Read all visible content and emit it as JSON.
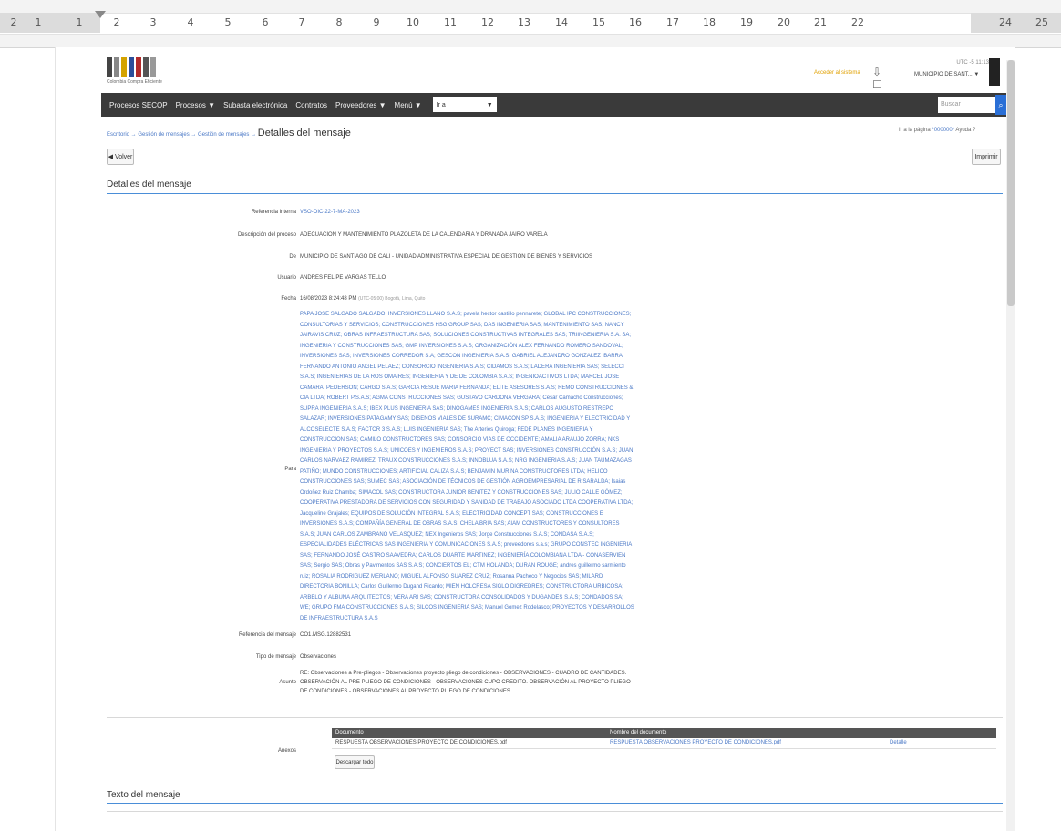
{
  "ruler": {
    "ticks": [
      "2",
      "1",
      "1",
      "2",
      "3",
      "4",
      "5",
      "6",
      "7",
      "8",
      "9",
      "10",
      "11",
      "12",
      "13",
      "14",
      "15",
      "16",
      "17",
      "18",
      "19",
      "20",
      "21",
      "22",
      "24",
      "25"
    ]
  },
  "header": {
    "logo_text": "Colombia Compra Eficiente",
    "notice": "Acceder al sistema",
    "user_time": "UTC -5 11:13",
    "user_entity": "MUNICIPIO DE SANT..."
  },
  "nav": {
    "items": [
      "Procesos SECOP",
      "Procesos ▼",
      "Subasta electrónica",
      "Contratos",
      "Proveedores ▼",
      "Menú ▼"
    ],
    "select_value": "Ir a",
    "search_placeholder": "Buscar"
  },
  "breadcrumb": {
    "path": "Escritorio → Gestión de mensajes → Gestión de mensajes →",
    "current": "Detalles del mensaje",
    "help_prefix": "Ir a la página",
    "help_link": "*000000*",
    "help_label": "Ayuda"
  },
  "buttons": {
    "back": "Volver",
    "print": "Imprimir",
    "download": "Descargar todo"
  },
  "details": {
    "section_title": "Detalles del mensaje",
    "fields": [
      {
        "label": "Referencia interna",
        "value": "VSO-OIC-22-7-MA-2023"
      },
      {
        "label": "Descripción del proceso",
        "value": "ADECUACIÓN Y MANTENIMIENTO PLAZOLETA DE LA CALENDARIA Y DRANADA JAIRO VARELA"
      },
      {
        "label": "De",
        "value": "MUNICIPIO DE SANTIAGO DE CALI - UNIDAD ADMINISTRATIVA ESPECIAL DE GESTION DE BIENES Y SERVICIOS"
      },
      {
        "label": "Usuario",
        "value": "ANDRES FELIPE VARGAS TELLO"
      },
      {
        "label": "Fecha",
        "value": "16/08/2023 8:24:48 PM",
        "note": "(UTC-05:00) Bogotá, Lima, Quito"
      }
    ],
    "para_label": "Para",
    "recipients": "PAPA JOSE SALGADO SALGADO; INVERSIONES LLANO S.A.S; pavela hector castillo pennarete; GLOBAL IPC CONSTRUCCIONES; CONSULTORIAS Y SERVICIOS; CONSTRUCCIONES HSG GROUP SAS; DAS INGENIERIA SAS; MANTENIMIENTO SAS; NANCY JAIRAVIS CRUZ; OBRAS INFRAESTRUCTURA SAS; SOLUCIONES CONSTRUCTIVAS INTEGRALES SAS; TRIINGENIERIA S.A. SA; INGENIERIA Y CONSTRUCCIONES SAS; GMP INVERSIONES S.A.S; ORGANIZACIÓN ALEX FERNANDO ROMERO SANDOVAL; INVERSIONES SAS; INVERSIONES CORREDOR S.A; GESCON INGENIERIA S.A.S; GABRIEL ALEJANDRO GONZALEZ IBARRA; FERNANDO ANTONIO ANGEL PELAEZ; CONSORCIO INGENIERIA S.A.S; CIDAMOS S.A.S; LADERA INGENIERIA SAS; SELECCI S.A.S; INGENIERIAS DE LA ROS OMAIRES; INGENIERIA Y DE DE COLOMBIA S.A.S; INGENIOACTIVOS LTDA; MARCEL JOSE CAMARA; PEDERSON; CARGO S.A.S; GARCIA RESUE MARIA FERNANDA; ELITE ASESORES S.A.S; REMO CONSTRUCCIONES & CIA LTDA; ROBERT P.S.A.S; AGMA CONSTRUCCIONES SAS; GUSTAVO CARDONA VERGARA; Cesar Camacho Construcciones; SUPRA INGENIERIA S.A.S; IBEX PLUS INGENIERIA SAS; DINOGAMES INGENIERIA S.A.S; CARLOS AUGUSTO RESTREPO SALAZAR; INVERSIONES PATAGAMY SAS; DISEÑOS VIALES DE SURAMC; CIMACON SP S.A.S; INGENIERIA Y ELECTRICIDAD Y ALCOSELECTE S.A.S; FACTOR 3 S.A.S; LUIS INGENIERIA SAS; The Arteries Quiroga; FEDE PLANES INGENIERIA Y CONSTRUCCIÓN SAS; CAMILO CONSTRUCTORES SAS; CONSORCIO VÍAS DE OCCIDENTE; AMALIA ARAÚJO ZORRA; NKS INGENIERIA Y PROYECTOS S.A.S; UNICOES Y INGENIEROS S.A.S; PROYECT SAS; INVERSIONES CONSTRUCCIÓN S.A.S; JUAN CARLOS NARVAEZ RAMIREZ; TRAUX CONSTRUCCIONES S.A.S; INNOBLUA S.A.S; NRG INGENIERIA S.A.S; JUAN TAUMAZAGAS PATIÑO; MUNDO CONSTRUCCIONES; ARTIFICIAL CALIZA S.A.S; BENJAMIN MURINA CONSTRUCTORES LTDA; HELICO CONSTRUCCIONES SAS; SUMEC SAS; ASOCIACIÓN DE TÉCNICOS DE GESTIÓN AGROEMPRESARIAL DE RISARALDA; Isaias Ordoñez Ruiz Chamba; SIMACOL SAS; CONSTRUCTORA JUNIOR BENITEZ Y CONSTRUCCIONES SAS; JULIO CALLE GÓMEZ; COOPERATIVA PRESTADORA DE SERVICIOS CON SEGURIDAD Y SANIDAD DE TRABAJO ASOCIADO LTDA COOPERATIVA LTDA; Jacqueline Grajales; EQUIPOS DE SOLUCIÓN INTEGRAL S.A.S; ELECTRICIDAD CONCEPT SAS; CONSTRUCCIONES E INVERSIONES S.A.S; COMPAÑÍA GENERAL DE OBRAS S.A.S; CHELA BRIA SAS; AIAM CONSTRUCTORES Y CONSULTORES S.A.S; JUAN CARLOS ZAMBRANO VELASQUEZ; NEX Ingenieros SAS; Jorge Construcciones S.A.S; CONDASA S.A.S; ESPECIALIDADES ELÉCTRICAS SAS INGENIERIA Y COMUNICACIONES S.A.S; proveedores s.a.s; GRUPO CONSTEC INGENIERIA SAS; FERNANDO JOSÉ CASTRO SAAVEDRA; CARLOS DUARTE MARTINEZ; INGENIERÍA COLOMBIANA LTDA - CONASERVIEN SAS; Sergio SAS; Obras y Pavimentos SAS S.A.S; CONCIERTOS EL; CTM HOLANDA; DURAN ROUGE; andres guillermo sarmiento ruiz; ROSALIA RODRIGUEZ MERLANO; MIGUEL ALFONSO SUAREZ CRUZ; Rosanna Pacheco Y Negocios SAS; MILARD DIRECTORIA BONILLA; Carlos Guillermo Dugand Ricardo; MIEN HOLCRESA SIGLO DIGREDRES; CONSTRUCTORA URBICOSA; ARBELO Y ALBUNA ARQUITECTOS; VERA ARI SAS; CONSTRUCTORA CONSOLIDADOS Y DUGANDES S.A.S; CONDADOS SA; WE; GRUPO FMA CONSTRUCCIONES S.A.S; SILCOS INGENIERIA SAS; Manuel Gomez Rodelasco; PROYECTOS Y DESARROLLOS DE INFRAESTRUCTURA S.A.S",
    "fields_bottom": [
      {
        "label": "Referencia del mensaje",
        "value": "CO1.MSG.12882531"
      },
      {
        "label": "Tipo de mensaje",
        "value": "Observaciones"
      }
    ],
    "subject_label": "Asunto",
    "subject": "RE: Observaciones a Pre-pliegos - Observaciones proyecto pliego de condiciones - OBSERVACIONES - CUADRO DE CANTIDADES. OBSERVACIÓN AL PRE PLIEGO DE CONDICIONES - OBSERVACIONES CUPO CREDITO. OBSERVACIÓN AL PROYECTO PLIEGO DE CONDICIONES - OBSERVACIONES AL PROYECTO PLIEGO DE CONDICIONES"
  },
  "attachments": {
    "label": "Anexos",
    "headers": [
      "Documento",
      "Nombre del documento"
    ],
    "rows": [
      {
        "document": "RESPUESTA OBSERVACIONES PROYECTO DE CONDICIONES.pdf",
        "name": "RESPUESTA OBSERVACIONES PROYECTO DE CONDICIONES.pdf",
        "action": "Detalle"
      }
    ]
  },
  "message_text": {
    "section_title": "Texto del mensaje"
  },
  "colors": {
    "accent": "#4a8ed8",
    "link": "#4a78c6",
    "nav_bg": "#3a3a3a",
    "search_btn": "#2a6fd6",
    "notice": "#e0a000"
  }
}
